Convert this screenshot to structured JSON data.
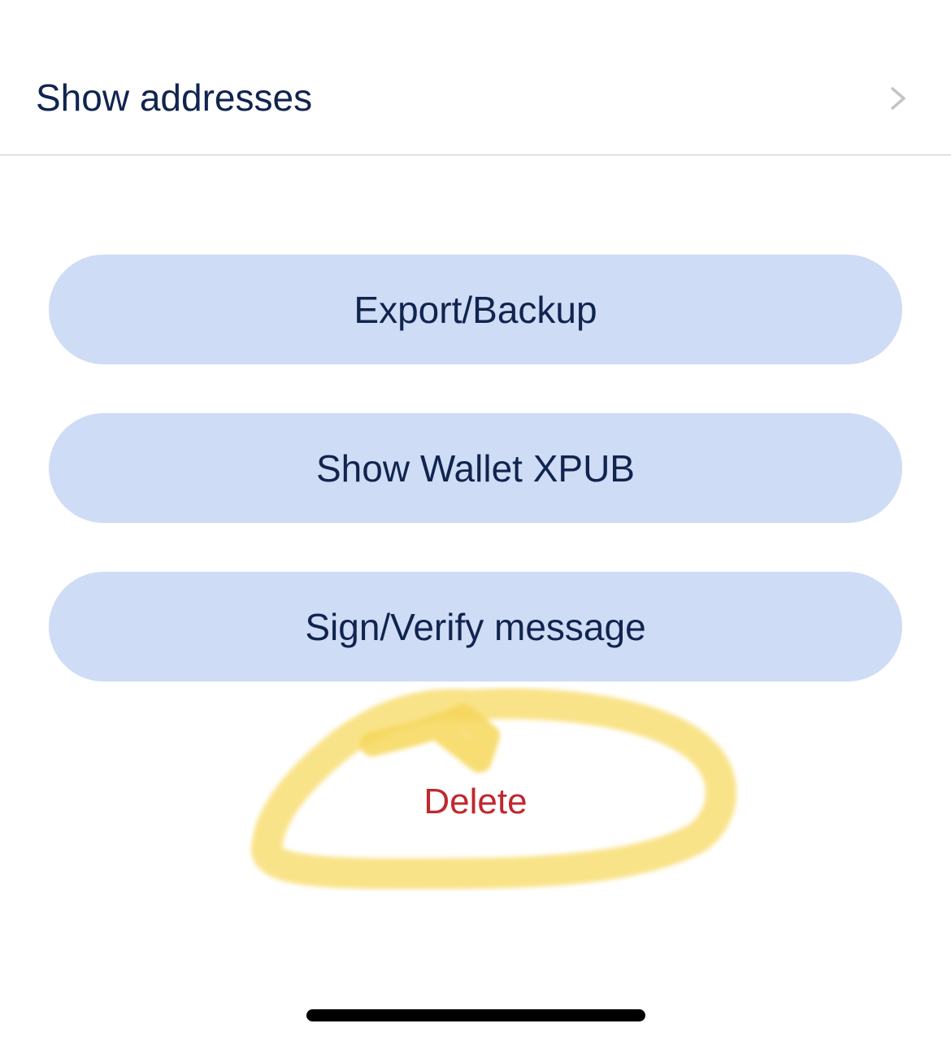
{
  "list": {
    "show_addresses_label": "Show addresses",
    "chevron_icon": "chevron-right-icon"
  },
  "actions": {
    "export_backup_label": "Export/Backup",
    "show_xpub_label": "Show Wallet XPUB",
    "sign_verify_label": "Sign/Verify message",
    "delete_label": "Delete"
  },
  "annotation": {
    "highlight_icon": "highlight-circle-annotation"
  },
  "colors": {
    "text_primary": "#10244f",
    "button_background": "#cfdcf5",
    "destructive": "#c1272d",
    "highlight": "#f7d85a",
    "separator": "#c8c8cc",
    "chevron": "#c4c4c8"
  }
}
